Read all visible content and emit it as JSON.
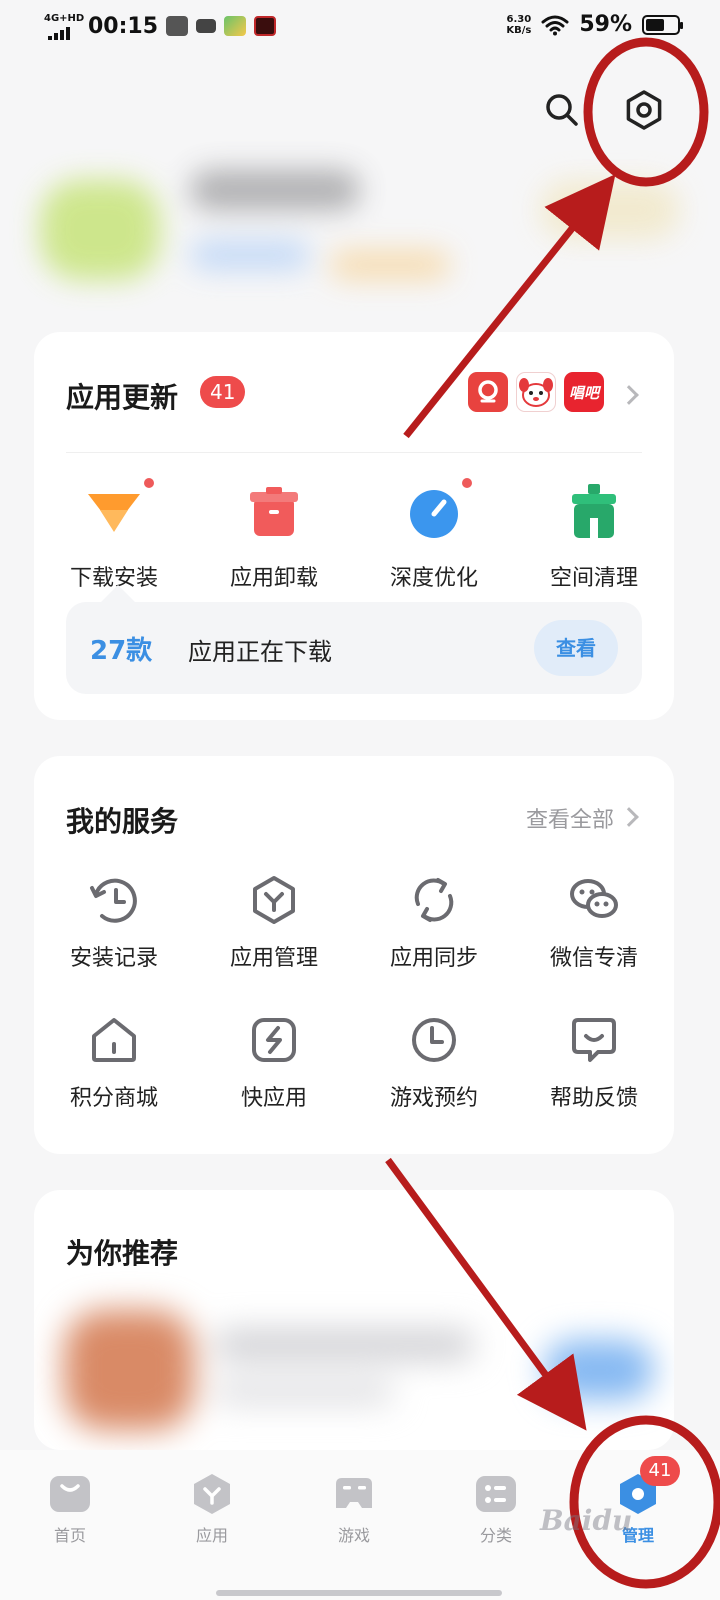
{
  "status_bar": {
    "network": "4G+HD",
    "time": "00:15",
    "speed_value": "6.30",
    "speed_unit": "KB/s",
    "battery": "59%",
    "battery_level": 0.59
  },
  "colors": {
    "accent": "#3b8fe3",
    "badge": "#ee4b4b",
    "annotation": "#b71c1c"
  },
  "header": {
    "search_icon": "search-icon",
    "settings_icon": "settings-icon"
  },
  "app_update": {
    "title": "应用更新",
    "badge": "41",
    "tools": [
      {
        "label": "下载安装",
        "icon": "download-install-icon",
        "dot": true
      },
      {
        "label": "应用卸载",
        "icon": "uninstall-icon",
        "dot": false
      },
      {
        "label": "深度优化",
        "icon": "optimize-icon",
        "dot": true
      },
      {
        "label": "空间清理",
        "icon": "cleanup-icon",
        "dot": false
      }
    ],
    "downloading": {
      "count": "27款",
      "text": "应用正在下载",
      "button": "查看"
    }
  },
  "services": {
    "title": "我的服务",
    "see_all": "查看全部",
    "items": [
      {
        "label": "安装记录",
        "icon": "install-history-icon"
      },
      {
        "label": "应用管理",
        "icon": "app-manage-icon"
      },
      {
        "label": "应用同步",
        "icon": "sync-icon"
      },
      {
        "label": "微信专清",
        "icon": "wechat-clean-icon"
      },
      {
        "label": "积分商城",
        "icon": "points-mall-icon"
      },
      {
        "label": "快应用",
        "icon": "quick-app-icon"
      },
      {
        "label": "游戏预约",
        "icon": "game-reserve-icon"
      },
      {
        "label": "帮助反馈",
        "icon": "help-feedback-icon"
      }
    ]
  },
  "recommend": {
    "title": "为你推荐"
  },
  "bottom_nav": {
    "items": [
      {
        "label": "首页",
        "icon": "home-icon"
      },
      {
        "label": "应用",
        "icon": "apps-icon"
      },
      {
        "label": "游戏",
        "icon": "game-icon"
      },
      {
        "label": "分类",
        "icon": "category-icon"
      },
      {
        "label": "管理",
        "icon": "manage-icon",
        "badge": "41",
        "active": true
      }
    ]
  },
  "watermark": "Baidu"
}
